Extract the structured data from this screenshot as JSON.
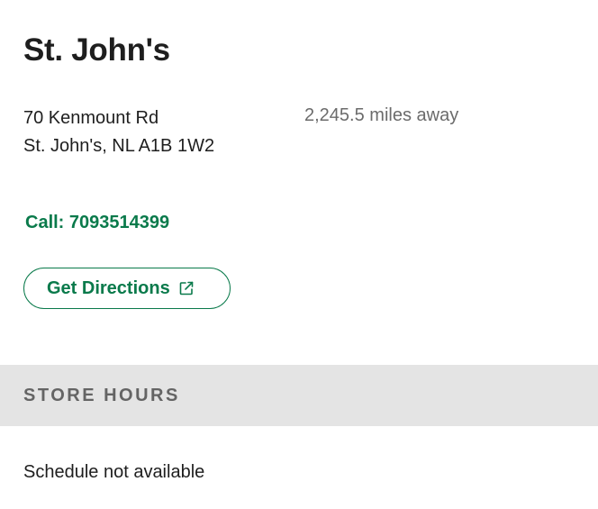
{
  "store": {
    "name": "St. John's",
    "address_line1": "70 Kenmount Rd",
    "address_line2": "St. John's, NL A1B 1W2",
    "distance": "2,245.5 miles away",
    "call_label": "Call: 7093514399",
    "directions_label": "Get Directions"
  },
  "hours": {
    "header": "STORE HOURS",
    "schedule_text": "Schedule not available"
  },
  "icons": {
    "directions": "external-link-icon"
  },
  "colors": {
    "accent": "#0a7a4b",
    "text": "#1e1e1e",
    "muted": "#6b6b6b",
    "section_bg": "#e4e4e4",
    "section_text": "#646464"
  }
}
